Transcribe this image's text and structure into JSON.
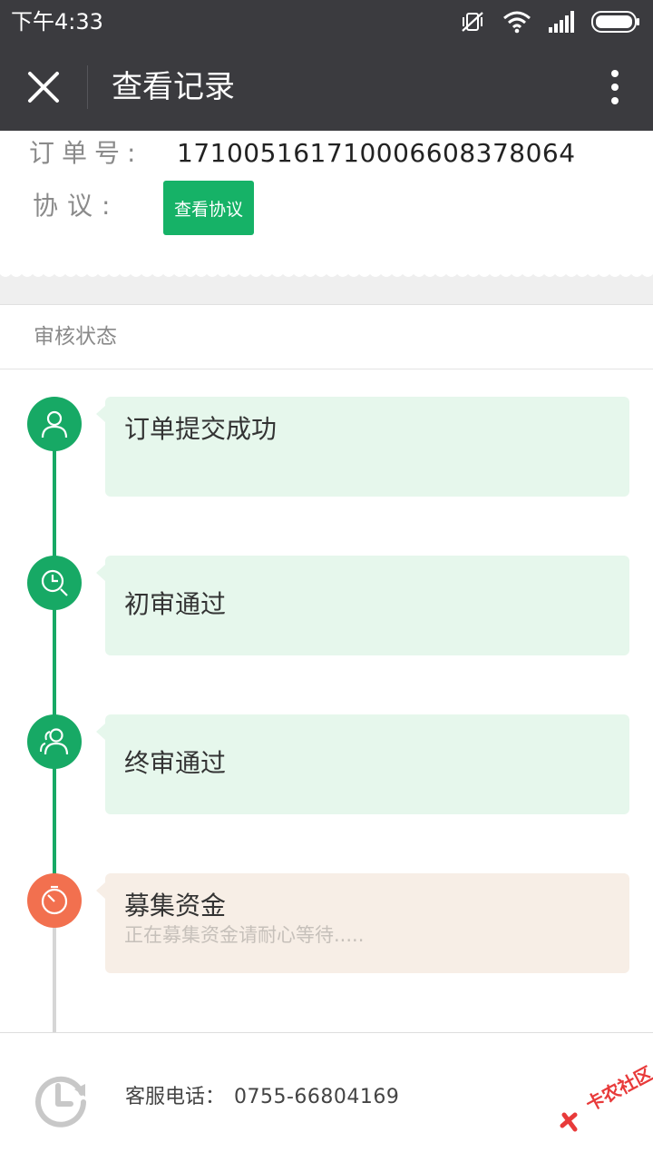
{
  "status_bar": {
    "time": "下午4:33",
    "icons": [
      "mute-vibrate-icon",
      "wifi-icon",
      "signal-icon",
      "battery-icon"
    ]
  },
  "header": {
    "title": "查看记录",
    "close_icon": "close-icon",
    "more_icon": "more-vertical-icon"
  },
  "order": {
    "order_label": "订单号:",
    "order_number": "171005161710006608378064",
    "agreement_label": "协议:",
    "agreement_button": "查看协议"
  },
  "review": {
    "section_title": "审核状态",
    "steps": [
      {
        "title": "订单提交成功",
        "desc": "",
        "status": "done",
        "icon": "user-icon"
      },
      {
        "title": "初审通过",
        "desc": "",
        "status": "done",
        "icon": "clock-search-icon"
      },
      {
        "title": "终审通过",
        "desc": "",
        "status": "done",
        "icon": "users-icon"
      },
      {
        "title": "募集资金",
        "desc": "正在募集资金请耐心等待.....",
        "status": "pending",
        "icon": "timer-icon"
      }
    ]
  },
  "footer": {
    "service_label": "客服电话：",
    "service_phone": "0755-66804169",
    "icon": "history-icon"
  },
  "watermark": {
    "text": "卡农社区"
  },
  "colors": {
    "header_bg": "#3b3b3f",
    "accent_green": "#17a965",
    "button_green": "#16b267",
    "pending_orange": "#f2704f",
    "card_done_bg": "#e6f7ec",
    "card_pending_bg": "#f7eee6"
  }
}
